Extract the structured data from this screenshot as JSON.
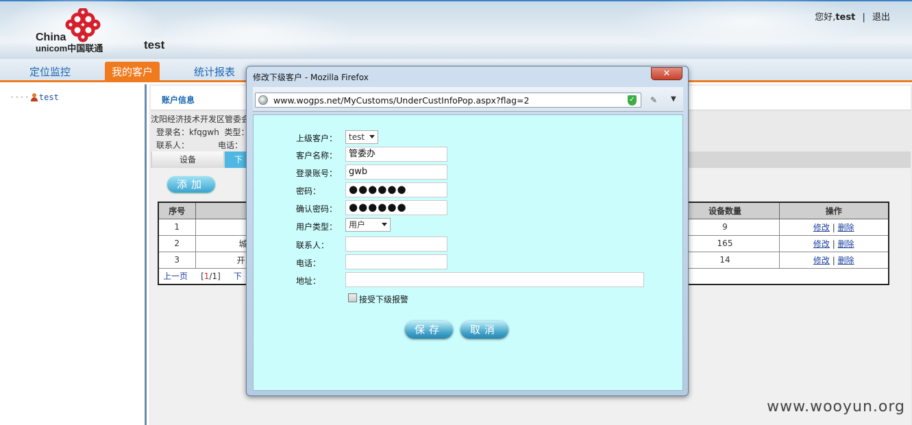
{
  "header": {
    "logo_line1": "China",
    "logo_line2": "unicom中国联通",
    "site_user": "test",
    "greeting_prefix": "您好,",
    "greeting_user": "test",
    "separator": "|",
    "logout": "退出"
  },
  "nav": {
    "items": [
      {
        "label": "定位监控"
      },
      {
        "label": "我的客户"
      },
      {
        "label": "统计报表"
      }
    ],
    "active_index": 1
  },
  "tree": {
    "dots": "····",
    "root_label": "test"
  },
  "main": {
    "account_tab": "账户信息",
    "org_name": "沈阳经济技术开发区管委会",
    "login_label": "登录名：kfqgwh",
    "type_label": "类型：",
    "contact_label": "联系人：",
    "phone_label": "电话：",
    "subtab_device": "设备",
    "subtab_lower": "下",
    "add_button": "添加",
    "table": {
      "headers": [
        "序号",
        "",
        "设备数量",
        "操作"
      ],
      "rows": [
        {
          "no": "1",
          "name": "",
          "count": "9"
        },
        {
          "no": "2",
          "name": "城",
          "count": "165"
        },
        {
          "no": "3",
          "name": "开",
          "count": "14"
        }
      ],
      "edit_label": "修改",
      "delete_label": "删除",
      "action_sep": "|"
    },
    "pager": {
      "prev": "上一页",
      "page_open": "[",
      "current": "1",
      "slash": "/",
      "total": "1",
      "page_close": "]",
      "next": "下"
    }
  },
  "popup": {
    "title": "修改下级客户 - Mozilla Firefox",
    "close_glyph": "✕",
    "url": "www.wogps.net/MyCustoms/UnderCustInfoPop.aspx?flag=2",
    "form": {
      "parent_label": "上级客户：",
      "parent_value": "test",
      "name_label": "客户名称：",
      "name_value": "管委办",
      "account_label": "登录账号：",
      "account_value": "gwb",
      "password_label": "密码：",
      "password_value": "●●●●●●",
      "confirm_label": "确认密码：",
      "confirm_value": "●●●●●●",
      "usertype_label": "用户类型：",
      "usertype_value": "用户",
      "contact_label": "联系人：",
      "contact_value": "",
      "phone_label": "电话：",
      "phone_value": "",
      "address_label": "地址：",
      "address_value": "",
      "accept_alarm_label": "接受下级报警",
      "save_button": "保存",
      "cancel_button": "取消"
    }
  },
  "watermark": "www.wooyun.org",
  "colors": {
    "accent_orange": "#f07a1e",
    "link_blue": "#1b66b4",
    "popup_bg": "#ccfdfd"
  }
}
